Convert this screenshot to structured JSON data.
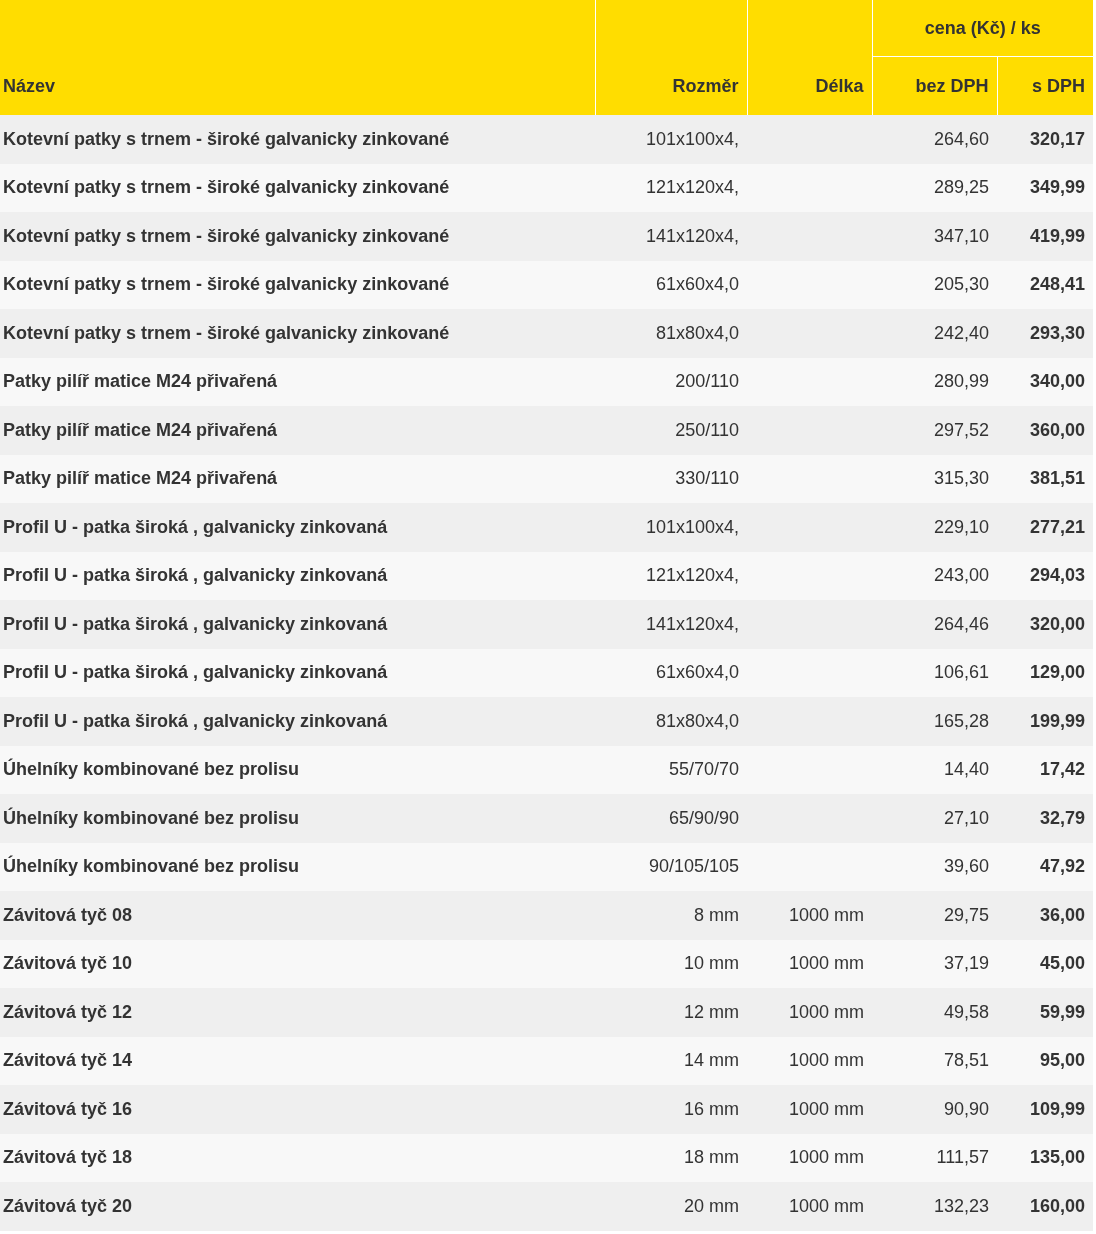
{
  "table": {
    "columns": {
      "name": "Název",
      "size": "Rozměr",
      "length": "Délka",
      "price_group": "cena (Kč) / ks",
      "net": "bez DPH",
      "gross": "s DPH"
    },
    "rows": [
      {
        "name": "Kotevní patky s trnem - široké galvanicky zinkované",
        "size": "101x100x4,",
        "length": "",
        "net": "264,60",
        "gross": "320,17"
      },
      {
        "name": "Kotevní patky s trnem - široké galvanicky zinkované",
        "size": "121x120x4,",
        "length": "",
        "net": "289,25",
        "gross": "349,99"
      },
      {
        "name": "Kotevní patky s trnem - široké galvanicky zinkované",
        "size": "141x120x4,",
        "length": "",
        "net": "347,10",
        "gross": "419,99"
      },
      {
        "name": "Kotevní patky s trnem - široké galvanicky zinkované",
        "size": "61x60x4,0",
        "length": "",
        "net": "205,30",
        "gross": "248,41"
      },
      {
        "name": "Kotevní patky s trnem - široké galvanicky zinkované",
        "size": "81x80x4,0",
        "length": "",
        "net": "242,40",
        "gross": "293,30"
      },
      {
        "name": "Patky pilíř matice M24 přivařená",
        "size": "200/110",
        "length": "",
        "net": "280,99",
        "gross": "340,00"
      },
      {
        "name": "Patky pilíř matice M24 přivařená",
        "size": "250/110",
        "length": "",
        "net": "297,52",
        "gross": "360,00"
      },
      {
        "name": "Patky pilíř matice M24 přivařená",
        "size": "330/110",
        "length": "",
        "net": "315,30",
        "gross": "381,51"
      },
      {
        "name": "Profil U - patka široká , galvanicky zinkovaná",
        "size": "101x100x4,",
        "length": "",
        "net": "229,10",
        "gross": "277,21"
      },
      {
        "name": "Profil U - patka široká , galvanicky zinkovaná",
        "size": "121x120x4,",
        "length": "",
        "net": "243,00",
        "gross": "294,03"
      },
      {
        "name": "Profil U - patka široká , galvanicky zinkovaná",
        "size": "141x120x4,",
        "length": "",
        "net": "264,46",
        "gross": "320,00"
      },
      {
        "name": "Profil U - patka široká , galvanicky zinkovaná",
        "size": "61x60x4,0",
        "length": "",
        "net": "106,61",
        "gross": "129,00"
      },
      {
        "name": "Profil U - patka široká , galvanicky zinkovaná",
        "size": "81x80x4,0",
        "length": "",
        "net": "165,28",
        "gross": "199,99"
      },
      {
        "name": "Úhelníky kombinované bez prolisu",
        "size": "55/70/70",
        "length": "",
        "net": "14,40",
        "gross": "17,42"
      },
      {
        "name": "Úhelníky kombinované bez prolisu",
        "size": "65/90/90",
        "length": "",
        "net": "27,10",
        "gross": "32,79"
      },
      {
        "name": "Úhelníky kombinované bez prolisu",
        "size": "90/105/105",
        "length": "",
        "net": "39,60",
        "gross": "47,92"
      },
      {
        "name": "Závitová tyč 08",
        "size": "8 mm",
        "length": "1000 mm",
        "net": "29,75",
        "gross": "36,00"
      },
      {
        "name": "Závitová tyč 10",
        "size": "10 mm",
        "length": "1000 mm",
        "net": "37,19",
        "gross": "45,00"
      },
      {
        "name": "Závitová tyč 12",
        "size": "12 mm",
        "length": "1000 mm",
        "net": "49,58",
        "gross": "59,99"
      },
      {
        "name": "Závitová tyč 14",
        "size": "14 mm",
        "length": "1000 mm",
        "net": "78,51",
        "gross": "95,00"
      },
      {
        "name": "Závitová tyč 16",
        "size": "16 mm",
        "length": "1000 mm",
        "net": "90,90",
        "gross": "109,99"
      },
      {
        "name": "Závitová tyč 18",
        "size": "18 mm",
        "length": "1000 mm",
        "net": "111,57",
        "gross": "135,00"
      },
      {
        "name": "Závitová tyč 20",
        "size": "20 mm",
        "length": "1000 mm",
        "net": "132,23",
        "gross": "160,00"
      }
    ]
  }
}
